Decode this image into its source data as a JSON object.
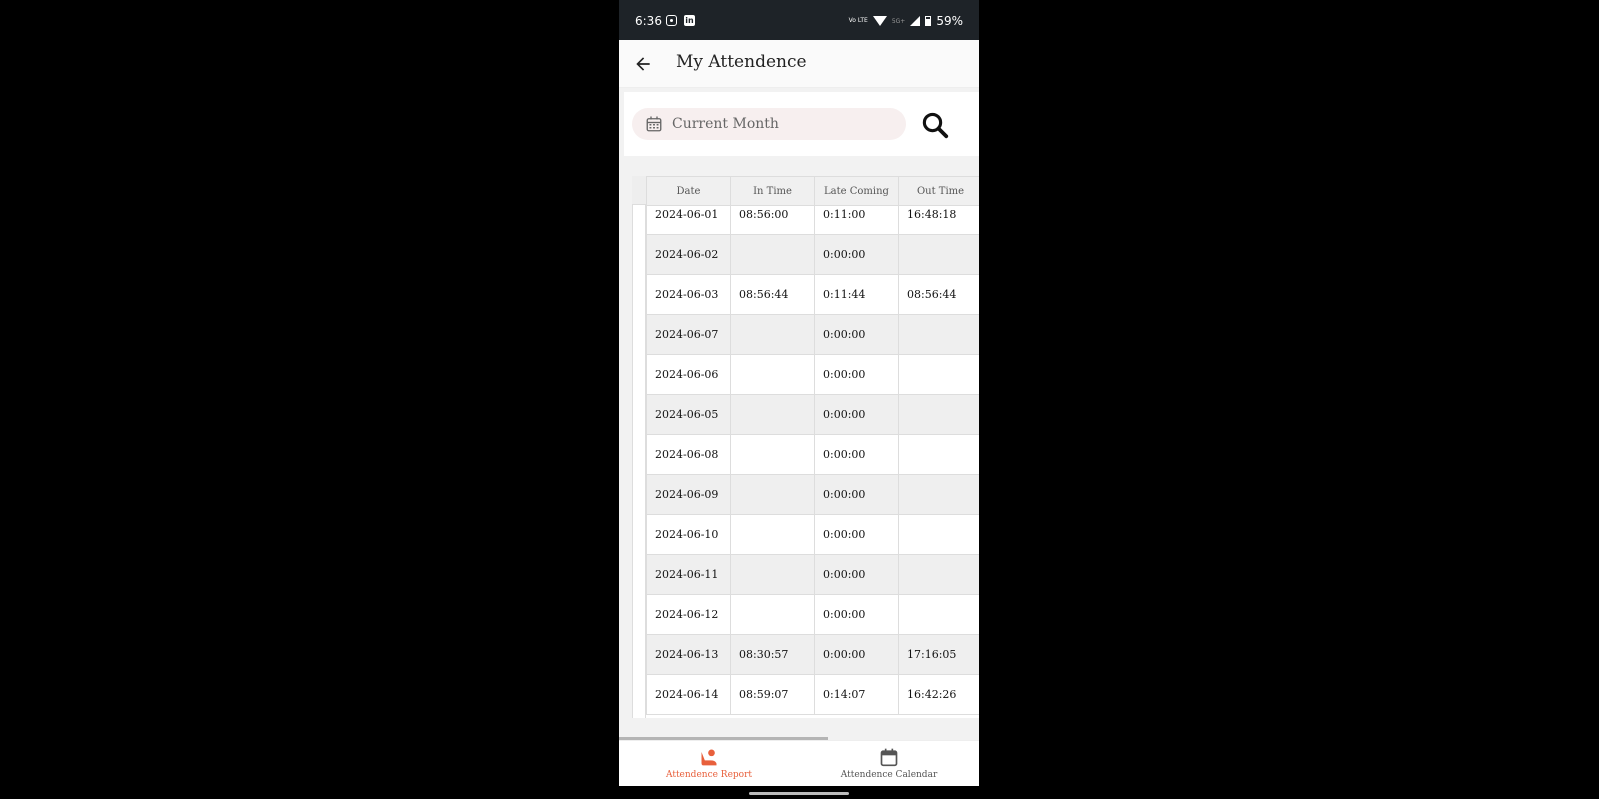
{
  "status_bar": {
    "time": "6:36",
    "volte": "Vo LTE",
    "network": "5G+",
    "battery": "59%"
  },
  "app_bar": {
    "title": "My Attendence"
  },
  "filter": {
    "month_placeholder": "Current Month"
  },
  "table": {
    "headers": [
      "Date",
      "In Time",
      "Late Coming",
      "Out Time"
    ],
    "rows": [
      [
        "2024-06-01",
        "08:56:00",
        "0:11:00",
        "16:48:18"
      ],
      [
        "2024-06-02",
        "",
        "0:00:00",
        ""
      ],
      [
        "2024-06-03",
        "08:56:44",
        "0:11:44",
        "08:56:44"
      ],
      [
        "2024-06-07",
        "",
        "0:00:00",
        ""
      ],
      [
        "2024-06-06",
        "",
        "0:00:00",
        ""
      ],
      [
        "2024-06-05",
        "",
        "0:00:00",
        ""
      ],
      [
        "2024-06-08",
        "",
        "0:00:00",
        ""
      ],
      [
        "2024-06-09",
        "",
        "0:00:00",
        ""
      ],
      [
        "2024-06-10",
        "",
        "0:00:00",
        ""
      ],
      [
        "2024-06-11",
        "",
        "0:00:00",
        ""
      ],
      [
        "2024-06-12",
        "",
        "0:00:00",
        ""
      ],
      [
        "2024-06-13",
        "08:30:57",
        "0:00:00",
        "17:16:05"
      ],
      [
        "2024-06-14",
        "08:59:07",
        "0:14:07",
        "16:42:26"
      ]
    ]
  },
  "bottom_nav": {
    "items": [
      {
        "label": "Attendence Report",
        "icon": "attendance-report-icon",
        "active": true
      },
      {
        "label": "Attendence Calendar",
        "icon": "calendar-icon",
        "active": false
      }
    ]
  },
  "colors": {
    "accent": "#e8603c",
    "status_bar": "#1e2328"
  }
}
